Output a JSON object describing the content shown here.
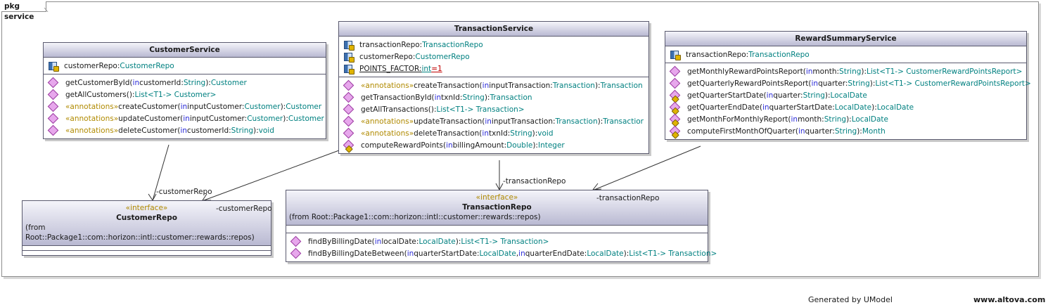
{
  "package": {
    "label": "pkg service"
  },
  "classes": {
    "customer_service": {
      "name": "CustomerService",
      "attributes": [
        {
          "name": "customerRepo:",
          "type": "CustomerRepo"
        }
      ],
      "operations": [
        {
          "prefix": "",
          "name": "getCustomerById(",
          "kw": "in",
          "param": " customerId:",
          "ptype": "String",
          "tail": "):",
          "ret": "Customer"
        },
        {
          "prefix": "",
          "name": "getAllCustomers():",
          "kw": "",
          "param": "",
          "ptype": "",
          "tail": "",
          "ret": "List<T1-> Customer>"
        },
        {
          "prefix": "«annotations» ",
          "name": "createCustomer(",
          "kw": "in",
          "param": " inputCustomer:",
          "ptype": "Customer",
          "tail": "):",
          "ret": "Customer"
        },
        {
          "prefix": "«annotations» ",
          "name": "updateCustomer(",
          "kw": "in",
          "param": " inputCustomer:",
          "ptype": "Customer",
          "tail": "):",
          "ret": "Customer"
        },
        {
          "prefix": "«annotations» ",
          "name": "deleteCustomer(",
          "kw": "in",
          "param": " customerId:",
          "ptype": "String",
          "tail": "):",
          "ret": "void"
        }
      ]
    },
    "transaction_service": {
      "name": "TransactionService",
      "attributes": [
        {
          "name": "transactionRepo:",
          "type": "TransactionRepo"
        },
        {
          "name": "customerRepo:",
          "type": "CustomerRepo"
        },
        {
          "name": "POINTS_FACTOR:",
          "type": "int",
          "value": "=1"
        }
      ],
      "operations": [
        {
          "prefix": "«annotations» ",
          "name": "createTransaction(",
          "kw": "in",
          "param": " inputTransaction:",
          "ptype": "Transaction",
          "tail": "):",
          "ret": "Transaction"
        },
        {
          "prefix": "",
          "name": "getTransactionById(",
          "kw": "in",
          "param": " txnId:",
          "ptype": "String",
          "tail": "):",
          "ret": "Transaction"
        },
        {
          "prefix": "",
          "name": "getAllTransactions():",
          "kw": "",
          "param": "",
          "ptype": "",
          "tail": "",
          "ret": "List<T1-> Transaction>"
        },
        {
          "prefix": "«annotations» ",
          "name": "updateTransaction(",
          "kw": "in",
          "param": " inputTransaction:",
          "ptype": "Transaction",
          "tail": "):",
          "ret": "Transactior"
        },
        {
          "prefix": "«annotations» ",
          "name": "deleteTransaction(",
          "kw": "in",
          "param": " txnId:",
          "ptype": "String",
          "tail": "):",
          "ret": "void"
        },
        {
          "prefix": "",
          "name": "computeRewardPoints(",
          "kw": "in",
          "param": " billingAmount:",
          "ptype": "Double",
          "tail": "):",
          "ret": "Integer"
        }
      ]
    },
    "reward_summary_service": {
      "name": "RewardSummaryService",
      "attributes": [
        {
          "name": "transactionRepo:",
          "type": "TransactionRepo"
        }
      ],
      "operations": [
        {
          "prefix": "",
          "name": "getMonthlyRewardPointsReport(",
          "kw": "in",
          "param": " month:",
          "ptype": "String",
          "tail": "):",
          "ret": "List<T1-> CustomerRewardPointsReport>"
        },
        {
          "prefix": "",
          "name": "getQuarterlyRewardPointsReport(",
          "kw": "in",
          "param": " quarter:",
          "ptype": "String",
          "tail": "):",
          "ret": "List<T1-> CustomerRewardPointsReport>"
        },
        {
          "prefix": "",
          "name": "getQuarterStartDate(",
          "kw": "in",
          "param": " quarter:",
          "ptype": "String",
          "tail": "):",
          "ret": "LocalDate"
        },
        {
          "prefix": "",
          "name": "getQuarterEndDate(",
          "kw": "in",
          "param": " quarterStartDate:",
          "ptype": "LocalDate",
          "tail": "):",
          "ret": "LocalDate"
        },
        {
          "prefix": "",
          "name": "getMonthForMonthlyReport(",
          "kw": "in",
          "param": " month:",
          "ptype": "String",
          "tail": "):",
          "ret": "LocalDate"
        },
        {
          "prefix": "",
          "name": "computeFirstMonthOfQuarter(",
          "kw": "in",
          "param": " quarter:",
          "ptype": "String",
          "tail": "):",
          "ret": "Month"
        }
      ]
    },
    "customer_repo": {
      "stereotype": "«interface»",
      "name": "CustomerRepo",
      "from": "(from Root::Package1::com::horizon::intl::customer::rewards::repos)"
    },
    "transaction_repo": {
      "stereotype": "«interface»",
      "name": "TransactionRepo",
      "from": "(from Root::Package1::com::horizon::intl::customer::rewards::repos)",
      "operations": [
        {
          "name": "findByBillingDate(",
          "kw": "in",
          "param": " localDate:",
          "ptype": "LocalDate",
          "tail": "):",
          "ret": "List<T1-> Transaction>"
        },
        {
          "name": "findByBillingDateBetween(",
          "kw": "in",
          "param": " quarterStartDate:",
          "ptype": "LocalDate",
          "sep": ", ",
          "kw2": "in",
          "param2": " quarterEndDate:",
          "ptype2": "LocalDate",
          "tail": "):",
          "ret": "List<T1-> Transaction>"
        }
      ]
    }
  },
  "associations": {
    "cs_to_customerrepo": "-customerRepo",
    "ts_to_customerrepo": "-customerRepo",
    "ts_to_transactionrepo": "-transactionRepo",
    "rs_to_transactionrepo": "-transactionRepo"
  },
  "footer": {
    "generated": "Generated by UModel",
    "site": "www.altova.com"
  }
}
